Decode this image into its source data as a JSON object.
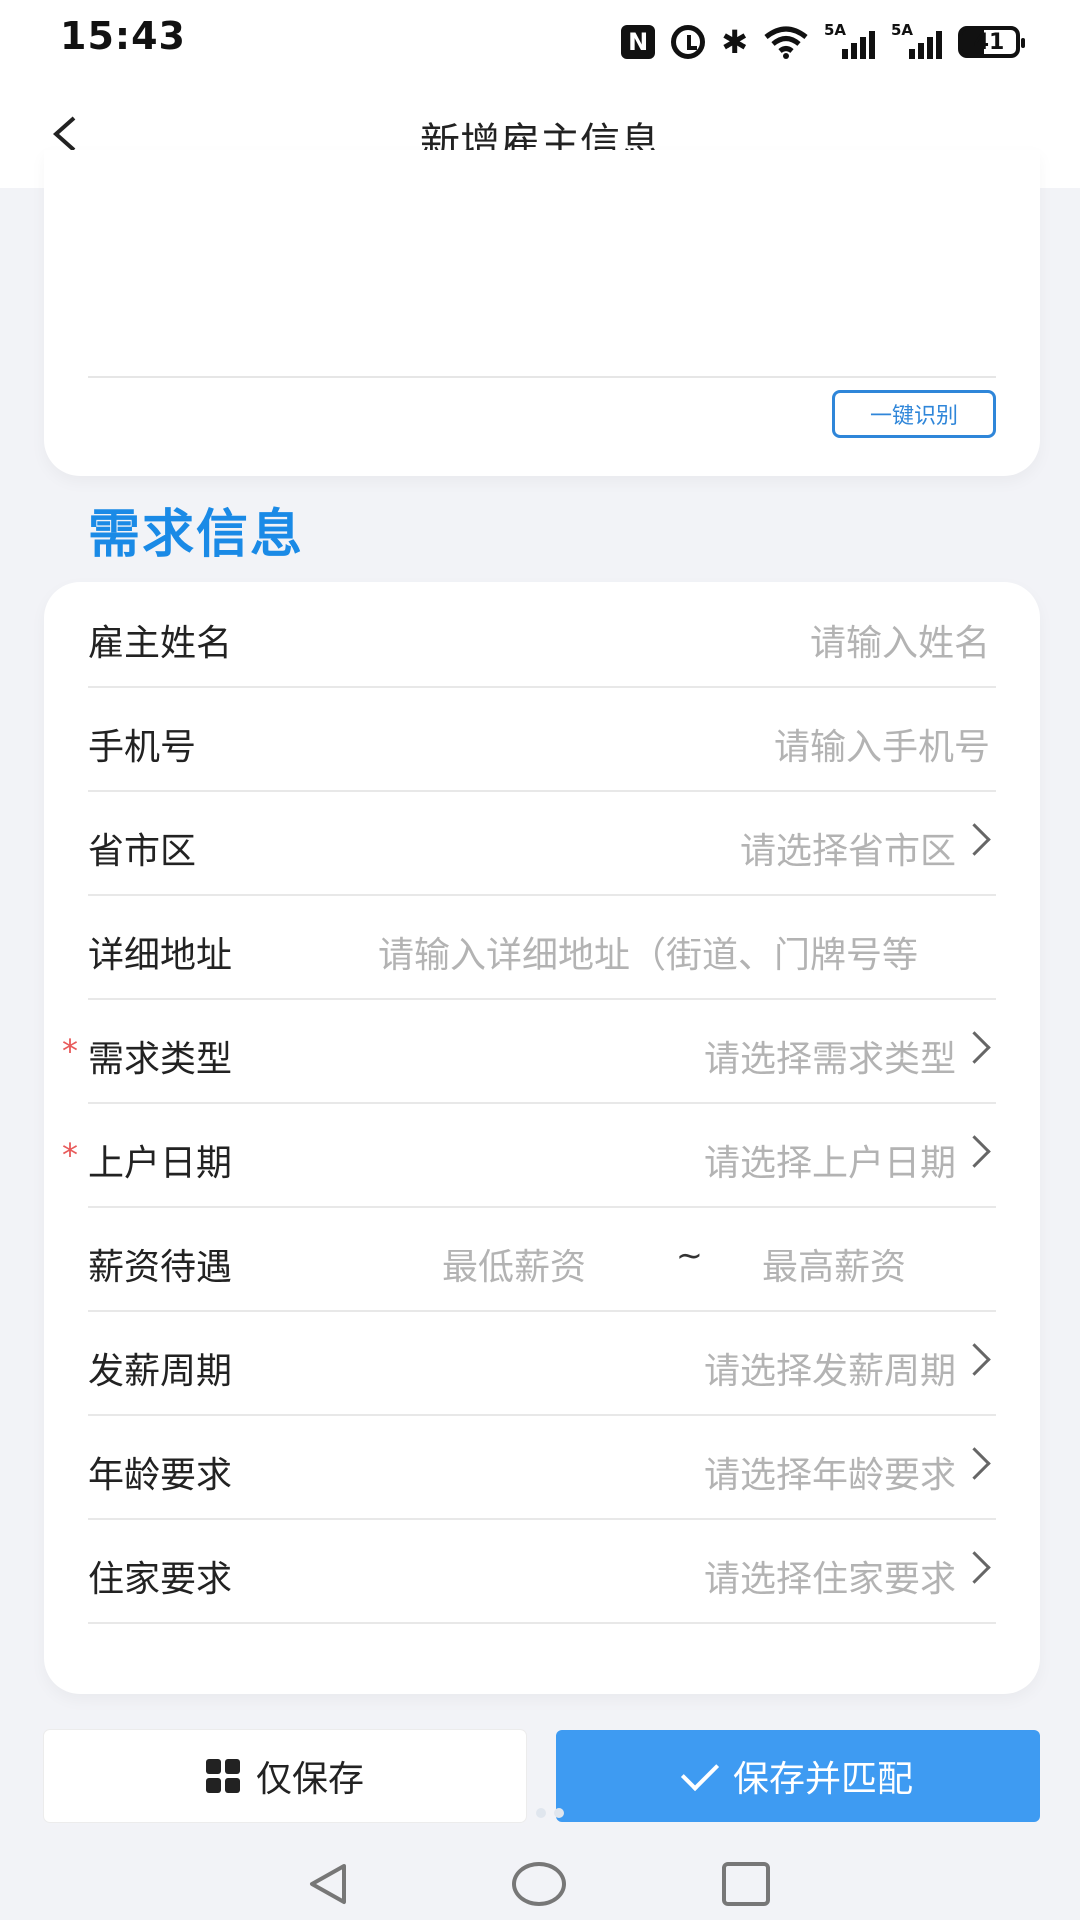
{
  "status_bar": {
    "time": "15:43",
    "network_label_1": "5A",
    "network_label_2": "5A",
    "battery": "41"
  },
  "header": {
    "title": "新增雇主信息"
  },
  "top_card": {
    "recognize_label": "一键识别"
  },
  "section": {
    "title": "需求信息"
  },
  "form": {
    "employer_name": {
      "label": "雇主姓名",
      "placeholder": "请输入姓名"
    },
    "phone": {
      "label": "手机号",
      "placeholder": "请输入手机号"
    },
    "region": {
      "label": "省市区",
      "placeholder": "请选择省市区"
    },
    "address": {
      "label": "详细地址",
      "placeholder": "请输入详细地址（街道、门牌号等"
    },
    "demand_type": {
      "label": "需求类型",
      "placeholder": "请选择需求类型",
      "required_mark": "*"
    },
    "start_date": {
      "label": "上户日期",
      "placeholder": "请选择上户日期",
      "required_mark": "*"
    },
    "salary": {
      "label": "薪资待遇",
      "min_placeholder": "最低薪资",
      "separator": "~",
      "max_placeholder": "最高薪资"
    },
    "pay_cycle": {
      "label": "发薪周期",
      "placeholder": "请选择发薪周期"
    },
    "age_req": {
      "label": "年龄要求",
      "placeholder": "请选择年龄要求"
    },
    "live_in": {
      "label": "住家要求",
      "placeholder": "请选择住家要求"
    }
  },
  "actions": {
    "save_only": "仅保存",
    "save_match": "保存并匹配"
  },
  "colors": {
    "accent": "#3e9bf2",
    "section_title": "#1a8ae6",
    "required": "#e85a5a"
  },
  "icons": [
    "back-icon",
    "grid-icon",
    "check-icon",
    "chevron-right-icon"
  ]
}
